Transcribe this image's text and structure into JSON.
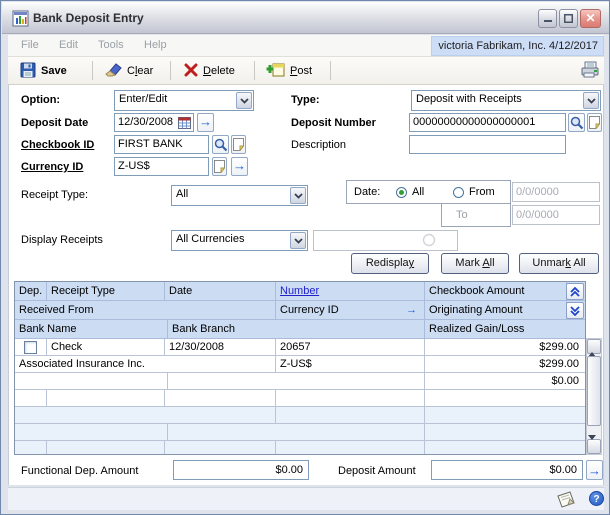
{
  "window": {
    "title": "Bank Deposit Entry"
  },
  "menubar": {
    "file": "File",
    "edit": "Edit",
    "tools": "Tools",
    "help": "Help",
    "user_context": "victoria  Fabrikam, Inc.  4/12/2017"
  },
  "toolbar": {
    "save": "Save",
    "clear": {
      "pre": "C",
      "u": "l",
      "post": "ear"
    },
    "delete": {
      "pre": "",
      "u": "D",
      "post": "elete"
    },
    "post": {
      "pre": "",
      "u": "P",
      "post": "ost"
    }
  },
  "fields": {
    "option": {
      "label": "Option:",
      "value": "Enter/Edit"
    },
    "type": {
      "label": "Type:",
      "value": "Deposit with Receipts"
    },
    "deposit_date": {
      "label": "Deposit Date",
      "value": "12/30/2008"
    },
    "deposit_number": {
      "label": "Deposit Number",
      "value": "00000000000000000001"
    },
    "checkbook_id": {
      "label": "Checkbook ID",
      "value": "FIRST BANK"
    },
    "description": {
      "label": "Description",
      "value": ""
    },
    "currency_id": {
      "label": "Currency ID",
      "value": "Z-US$"
    },
    "receipt_type": {
      "label": "Receipt Type:",
      "value": "All"
    },
    "display_receipts": {
      "label": "Display Receipts",
      "value": "All Currencies"
    },
    "date_filter": {
      "label": "Date:",
      "all": "All",
      "from": "From",
      "to": "To",
      "from_value": "0/0/0000",
      "to_value": "0/0/0000"
    }
  },
  "actions": {
    "redisplay": {
      "pre": "Redispla",
      "u": "y",
      "post": ""
    },
    "mark_all": {
      "pre": "Mark ",
      "u": "A",
      "post": "ll"
    },
    "unmark_all": {
      "pre": "Unmar",
      "u": "k",
      "post": " All"
    }
  },
  "grid": {
    "headers": {
      "dep": "Dep.",
      "receipt_type": "Receipt Type",
      "date": "Date",
      "number": "Number",
      "checkbook_amount": "Checkbook Amount",
      "received_from": "Received From",
      "currency_id": "Currency ID",
      "originating_amount": "Originating Amount",
      "bank_name": "Bank Name",
      "bank_branch": "Bank Branch",
      "realized_gain_loss": "Realized Gain/Loss"
    },
    "record": {
      "receipt_type": "Check",
      "date": "12/30/2008",
      "number": "20657",
      "checkbook_amount": "$299.00",
      "received_from": "Associated Insurance Inc.",
      "currency_id": "Z-US$",
      "originating_amount": "$299.00",
      "realized_gain_loss": "$0.00"
    }
  },
  "totals": {
    "functional": {
      "label": "Functional Dep. Amount",
      "value": "$0.00"
    },
    "deposit": {
      "label": "Deposit Amount",
      "value": "$0.00"
    }
  }
}
